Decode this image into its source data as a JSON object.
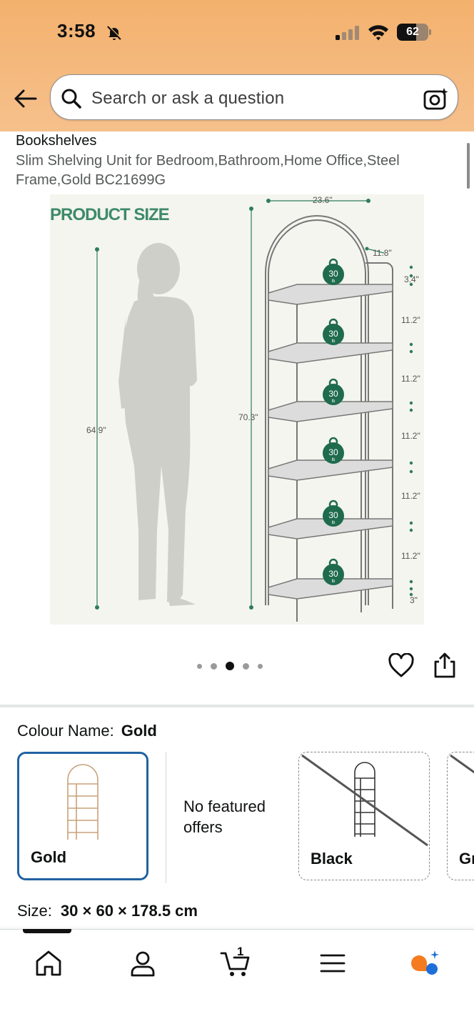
{
  "status_bar": {
    "time": "3:58",
    "battery": "62",
    "battery_level": 0.62
  },
  "header": {
    "search_placeholder": "Search or ask a question"
  },
  "product": {
    "breadcrumb": "Bookshelves",
    "title": "Slim Shelving Unit for Bedroom,Bathroom,Home Office,Steel Frame,Gold BC21699G"
  },
  "image": {
    "heading": "PRODUCT SIZE",
    "person_height": "64.9\"",
    "total_height": "70.3\"",
    "width": "23.6\"",
    "depth": "11.8\"",
    "top_gap": "3.4\"",
    "shelf_gap": "11.2\"",
    "bottom_gap": "3\"",
    "load_value": "30",
    "load_unit": "lb"
  },
  "carousel": {
    "total": 5,
    "active_index": 2
  },
  "colour": {
    "label": "Colour Name:",
    "selected": "Gold",
    "options": [
      {
        "name": "Gold"
      },
      {
        "name": "Black"
      },
      {
        "name": "Gr"
      }
    ],
    "no_offers": "No featured offers"
  },
  "size": {
    "label": "Size:",
    "value": "30 × 60 × 178.5 cm"
  },
  "nav": {
    "cart_count": "1"
  },
  "colors": {
    "header": "#f3b16d",
    "selected_border": "#2162a1",
    "badge_green": "#1f6b4e"
  },
  "icons": [
    "back-arrow-icon",
    "search-icon",
    "camera-icon",
    "heart-icon",
    "share-icon",
    "home-icon",
    "account-icon",
    "cart-icon",
    "menu-icon",
    "rufus-icon"
  ]
}
